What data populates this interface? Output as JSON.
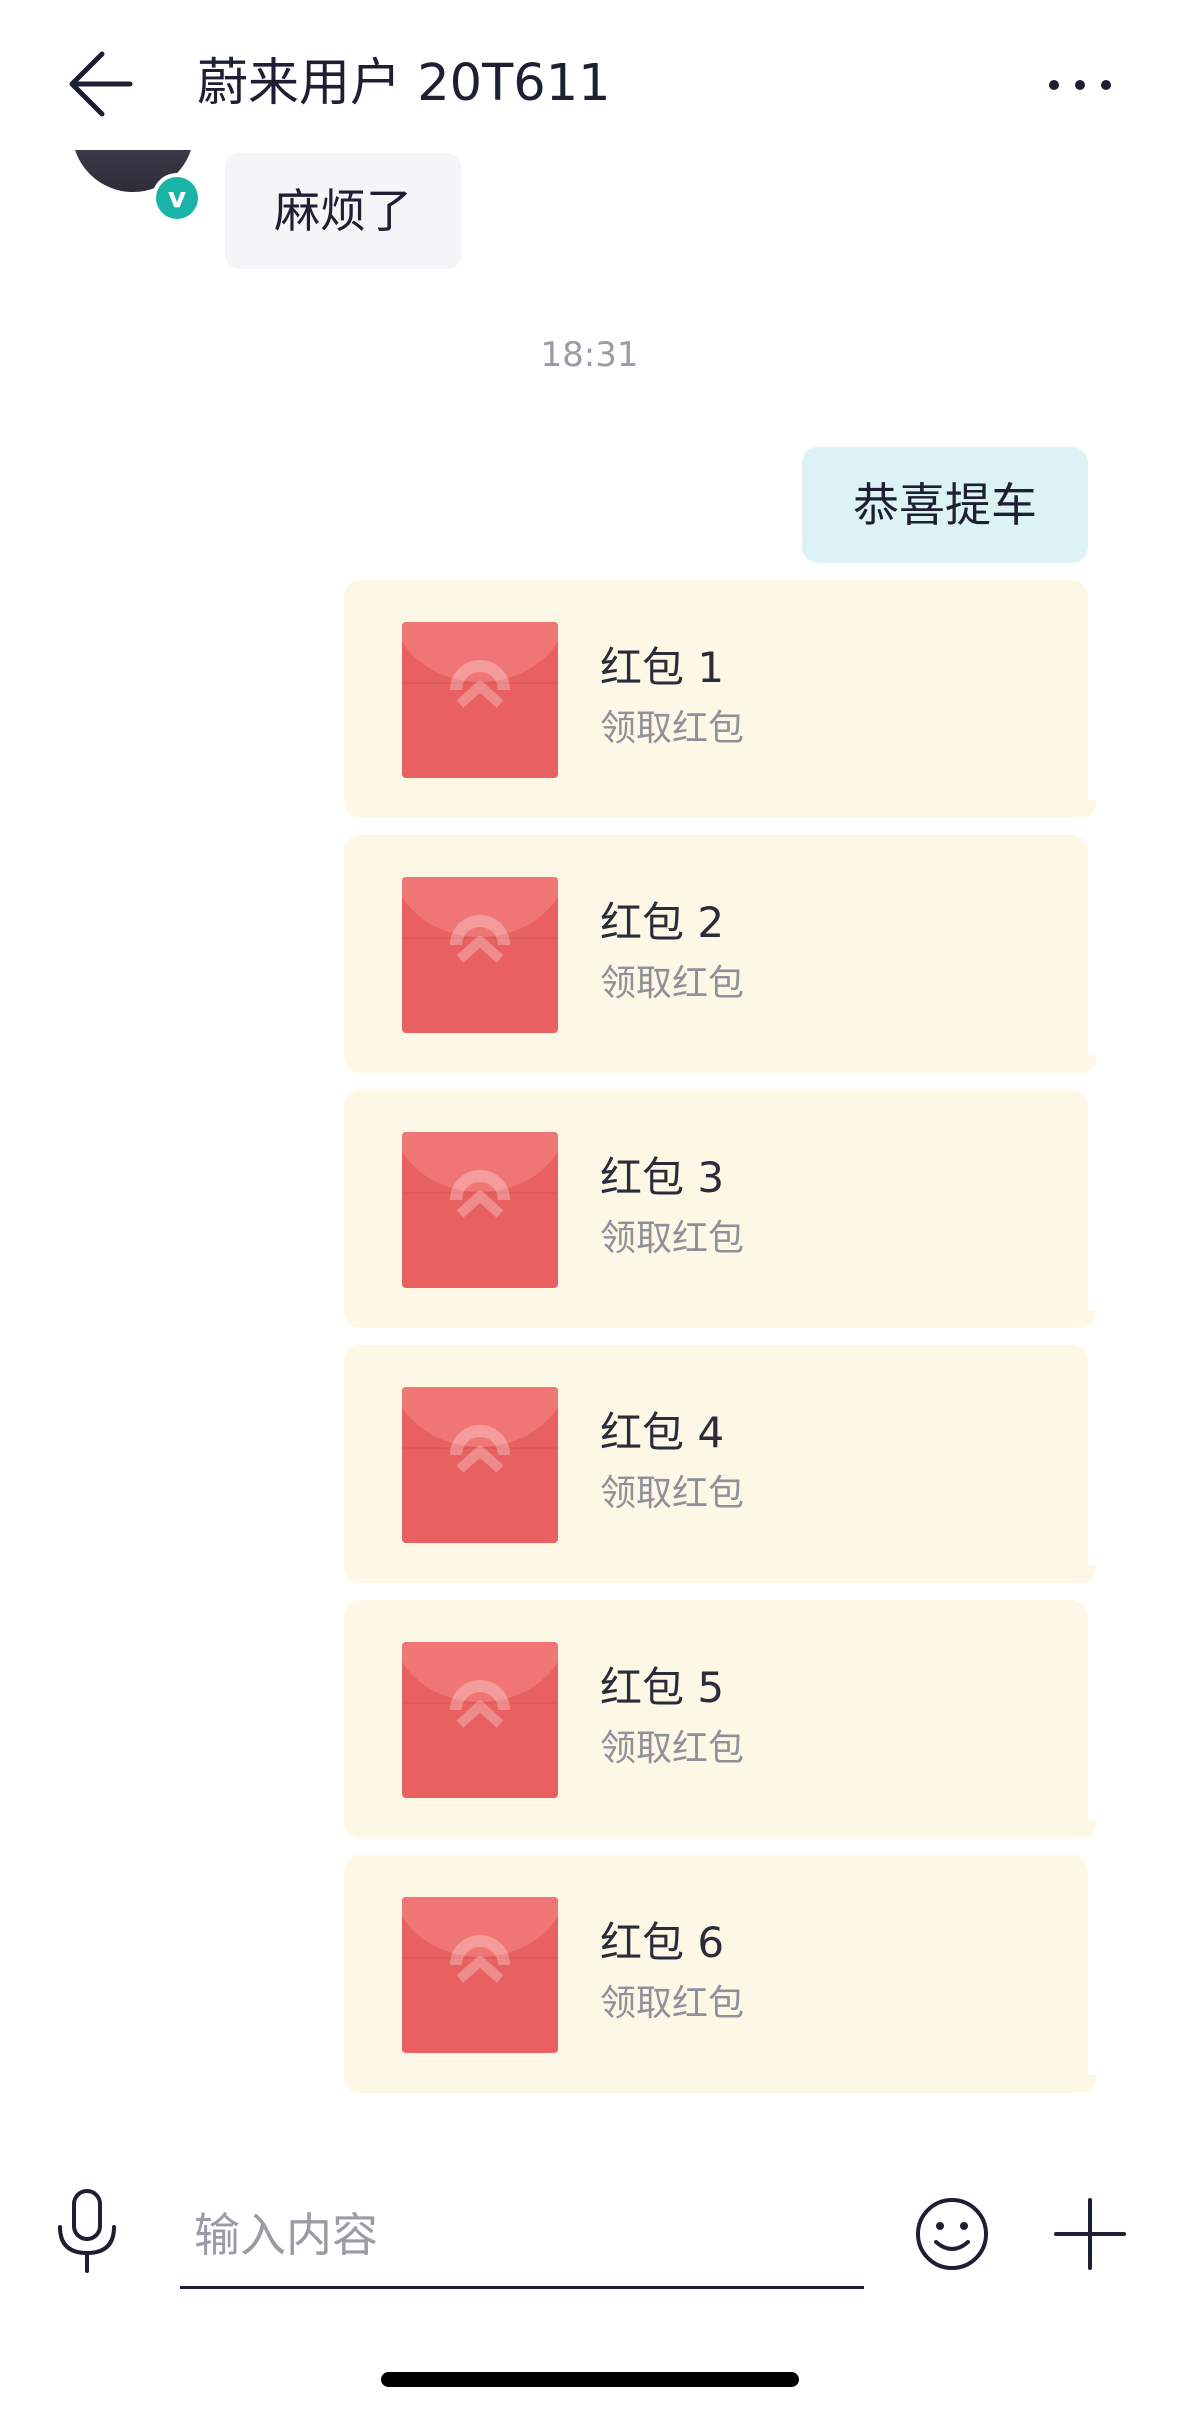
{
  "header": {
    "title": "蔚来用户 20T611"
  },
  "incoming": {
    "badge_letter": "v",
    "message": "麻烦了"
  },
  "timestamp": "18:31",
  "outgoing": {
    "message": "恭喜提车"
  },
  "red_packets": [
    {
      "title": "红包 1",
      "action": "领取红包"
    },
    {
      "title": "红包 2",
      "action": "领取红包"
    },
    {
      "title": "红包 3",
      "action": "领取红包"
    },
    {
      "title": "红包 4",
      "action": "领取红包"
    },
    {
      "title": "红包 5",
      "action": "领取红包"
    },
    {
      "title": "红包 6",
      "action": "领取红包"
    }
  ],
  "input": {
    "placeholder": "输入内容"
  },
  "colors": {
    "incoming_bubble": "#f5f5f7",
    "outgoing_bubble": "#dcf2f4",
    "packet_bubble": "#fdf8e6",
    "envelope": "#e86060",
    "badge": "#18b5a7"
  },
  "icons": [
    "back-arrow-icon",
    "more-dots-icon",
    "microphone-icon",
    "emoji-icon",
    "plus-icon",
    "verified-badge-icon",
    "red-envelope-icon"
  ]
}
